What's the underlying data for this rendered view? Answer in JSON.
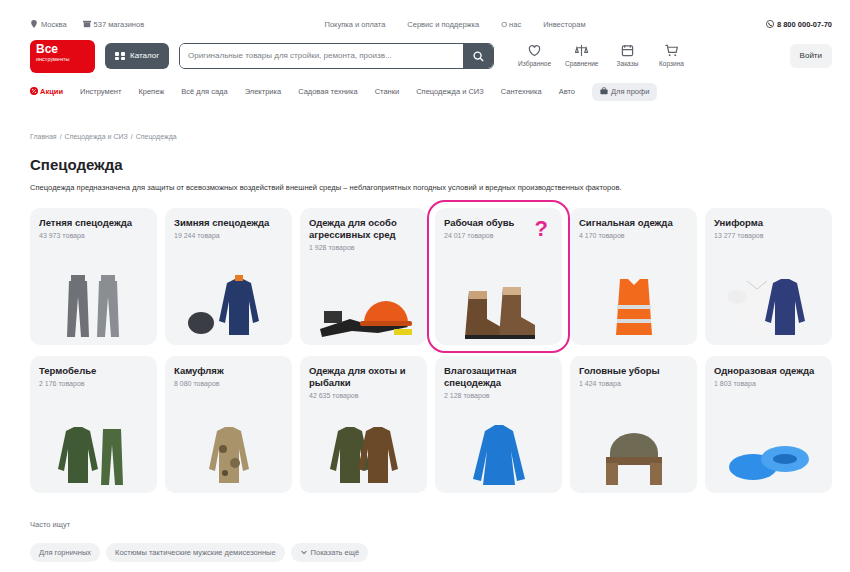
{
  "topbar": {
    "city": "Москва",
    "stores": "537 магазинов",
    "links": [
      "Покупка и оплата",
      "Сервис и поддержка",
      "О нас",
      "Инвесторам"
    ],
    "phone": "8 800 000-07-70"
  },
  "header": {
    "logo_top": "Все",
    "logo_bottom": "инструменты",
    "catalog": "Каталог",
    "search": {
      "placeholder": "Оригинальные товары для стройки, ремонта, произв..."
    },
    "actions": [
      "Избранное",
      "Сравнение",
      "Заказы",
      "Корзина"
    ],
    "login": "Войти"
  },
  "nav": [
    {
      "label": "Акции",
      "kind": "promo"
    },
    {
      "label": "Инструмент",
      "kind": "link"
    },
    {
      "label": "Крепеж",
      "kind": "link"
    },
    {
      "label": "Всё для сада",
      "kind": "link"
    },
    {
      "label": "Электрика",
      "kind": "link"
    },
    {
      "label": "Садовая техника",
      "kind": "link"
    },
    {
      "label": "Станки",
      "kind": "link"
    },
    {
      "label": "Спецодежда и СИЗ",
      "kind": "link"
    },
    {
      "label": "Сантехника",
      "kind": "link"
    },
    {
      "label": "Авто",
      "kind": "link"
    },
    {
      "label": "Для профи",
      "kind": "pill"
    }
  ],
  "breadcrumbs": [
    "Главная",
    "Спецодежда и СИЗ",
    "Спецодежда"
  ],
  "title": "Спецодежда",
  "description": "Спецодежда предназначена для защиты от всевозможных воздействий внешней среды – неблагоприятных погодных условий и вредных производственных факторов.",
  "categories": [
    {
      "title": "Летняя спецодежда",
      "count": "43 973 товара",
      "highlighted": false
    },
    {
      "title": "Зимняя спецодежда",
      "count": "19 244 товара",
      "highlighted": false
    },
    {
      "title": "Одежда для особо агрессивных сред",
      "count": "1 928 товаров",
      "highlighted": false
    },
    {
      "title": "Рабочая обувь",
      "count": "24 017 товаров",
      "highlighted": true
    },
    {
      "title": "Сигнальная одежда",
      "count": "4 170 товаров",
      "highlighted": false
    },
    {
      "title": "Униформа",
      "count": "13 277 товаров",
      "highlighted": false
    },
    {
      "title": "Термобелье",
      "count": "2 176 товаров",
      "highlighted": false
    },
    {
      "title": "Камуфляж",
      "count": "8 080 товаров",
      "highlighted": false
    },
    {
      "title": "Одежда для охоты и рыбалки",
      "count": "42 635 товаров",
      "highlighted": false
    },
    {
      "title": "Влагозащитная спецодежда",
      "count": "2 128 товаров",
      "highlighted": false
    },
    {
      "title": "Головные уборы",
      "count": "1 424 товара",
      "highlighted": false
    },
    {
      "title": "Одноразовая одежда",
      "count": "1 803 товара",
      "highlighted": false
    }
  ],
  "annotation": "?",
  "frequent": {
    "title": "Часто ищут",
    "chips": [
      "Для горничных",
      "Костюмы тактические мужские демисезонные"
    ],
    "more": "Показать ещё"
  }
}
